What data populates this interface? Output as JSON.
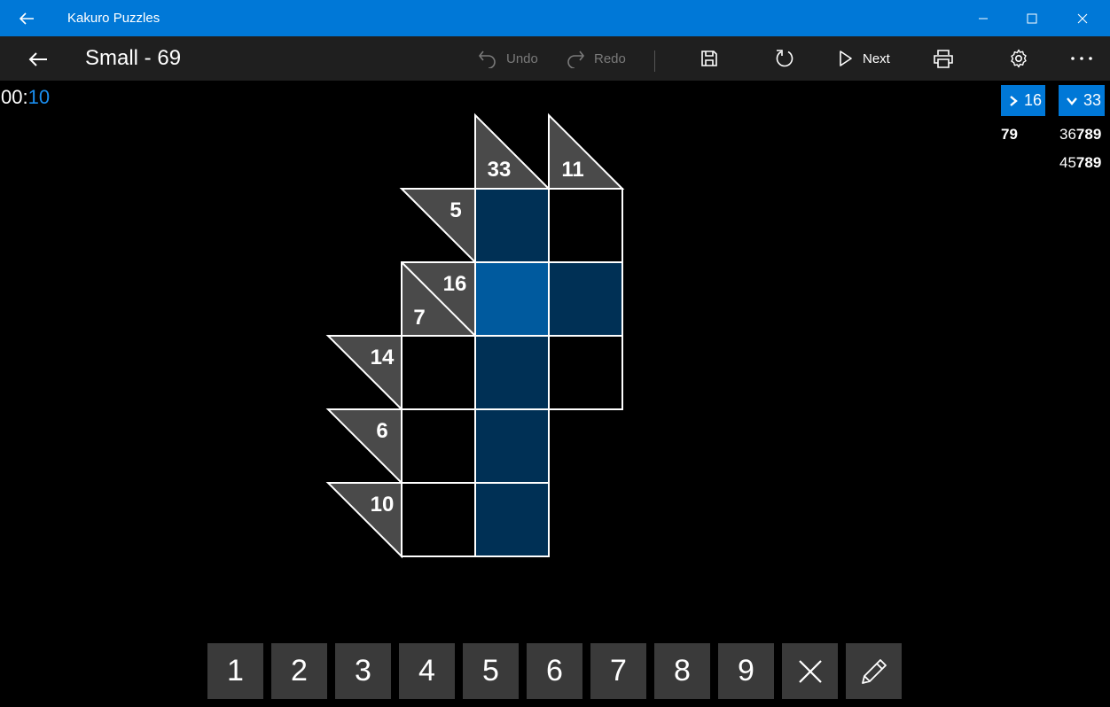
{
  "window": {
    "title": "Kakuro Puzzles"
  },
  "header": {
    "title": "Small - 69"
  },
  "toolbar": {
    "undo_label": "Undo",
    "redo_label": "Redo",
    "next_label": "Next"
  },
  "timer": {
    "min": "00",
    "sep": ":",
    "sec": "10"
  },
  "hints": [
    {
      "icon": "chevron-right-icon",
      "value": "16"
    },
    {
      "icon": "chevron-down-icon",
      "value": "33"
    }
  ],
  "combos": {
    "across": [
      [
        {
          "t": "79",
          "b": true
        }
      ]
    ],
    "down": [
      [
        {
          "t": "36",
          "b": false
        },
        {
          "t": "789",
          "b": true
        }
      ],
      [
        {
          "t": "45",
          "b": false
        },
        {
          "t": "789",
          "b": true
        }
      ]
    ]
  },
  "board": {
    "clues": [
      {
        "row": 0,
        "col": 2,
        "down": "33"
      },
      {
        "row": 0,
        "col": 3,
        "down": "11"
      },
      {
        "row": 1,
        "col": 1,
        "across": "5"
      },
      {
        "row": 2,
        "col": 1,
        "across": "16",
        "down": "7"
      },
      {
        "row": 3,
        "col": 0,
        "across": "14"
      },
      {
        "row": 4,
        "col": 0,
        "across": "6"
      },
      {
        "row": 5,
        "col": 0,
        "across": "10"
      }
    ],
    "cells": [
      {
        "row": 1,
        "col": 2,
        "state": "highlight"
      },
      {
        "row": 1,
        "col": 3,
        "state": "empty"
      },
      {
        "row": 2,
        "col": 2,
        "state": "selected"
      },
      {
        "row": 2,
        "col": 3,
        "state": "highlight"
      },
      {
        "row": 3,
        "col": 1,
        "state": "empty"
      },
      {
        "row": 3,
        "col": 2,
        "state": "highlight"
      },
      {
        "row": 3,
        "col": 3,
        "state": "empty"
      },
      {
        "row": 4,
        "col": 1,
        "state": "empty"
      },
      {
        "row": 4,
        "col": 2,
        "state": "highlight"
      },
      {
        "row": 5,
        "col": 1,
        "state": "empty"
      },
      {
        "row": 5,
        "col": 2,
        "state": "highlight"
      }
    ]
  },
  "keypad": {
    "keys": [
      "1",
      "2",
      "3",
      "4",
      "5",
      "6",
      "7",
      "8",
      "9"
    ],
    "tools": [
      "close-icon",
      "pencil-icon"
    ]
  },
  "colors": {
    "accent": "#0078d7",
    "cell_highlight": "#003055",
    "cell_selected": "#005a9e",
    "clue_fill": "#4a4a4a",
    "grid_line": "#ffffff",
    "keypad_bg": "#3a3a3a"
  }
}
